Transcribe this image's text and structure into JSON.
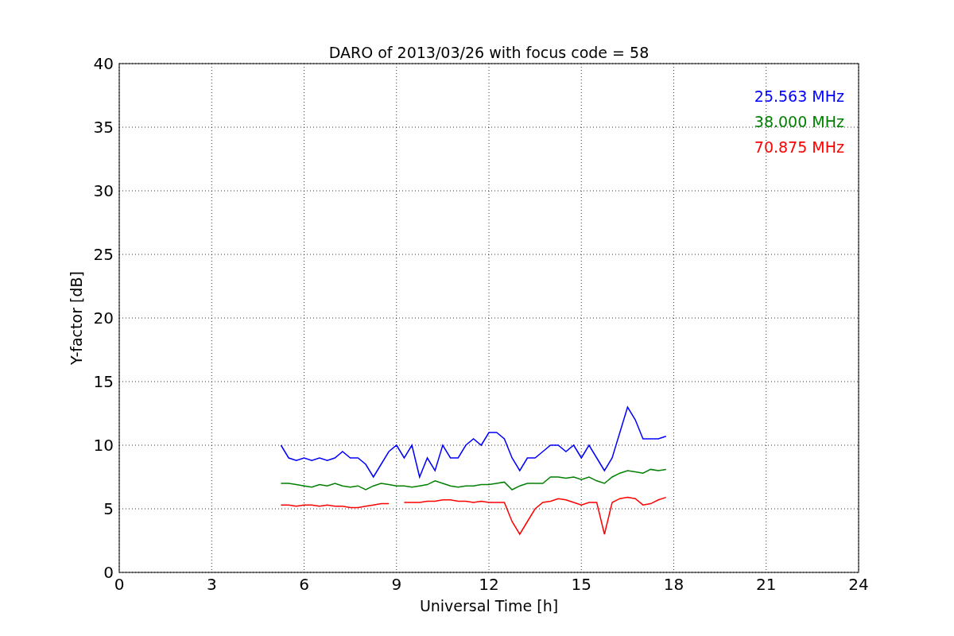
{
  "figure": {
    "chart_data": {
      "type": "line",
      "title": "DARO of 2013/03/26 with focus code = 58",
      "xlabel": "Universal Time [h]",
      "ylabel": "Y-factor [dB]",
      "xlim": [
        0,
        24
      ],
      "ylim": [
        0,
        40
      ],
      "grid": true,
      "xticks": [
        0,
        3,
        6,
        9,
        12,
        15,
        18,
        21,
        24
      ],
      "yticks": [
        0,
        5,
        10,
        15,
        20,
        25,
        30,
        35,
        40
      ],
      "x": [
        5.25,
        5.5,
        5.75,
        6,
        6.25,
        6.5,
        6.75,
        7,
        7.25,
        7.5,
        7.75,
        8,
        8.25,
        8.5,
        8.75,
        9,
        9.25,
        9.5,
        9.75,
        10,
        10.25,
        10.5,
        10.75,
        11,
        11.25,
        11.5,
        11.75,
        12,
        12.25,
        12.5,
        12.75,
        13,
        13.25,
        13.5,
        13.75,
        14,
        14.25,
        14.5,
        14.75,
        15,
        15.25,
        15.5,
        15.75,
        16,
        16.25,
        16.5,
        16.75,
        17,
        17.25,
        17.5,
        17.75
      ],
      "series": [
        {
          "name": "25.563 MHz",
          "color": "#0000ff",
          "values": [
            10,
            9,
            8.8,
            9,
            8.8,
            9,
            8.8,
            9,
            9.5,
            9,
            9,
            8.5,
            7.5,
            8.5,
            9.5,
            10,
            9,
            10,
            7.5,
            9,
            8,
            10,
            9,
            9,
            10,
            10.5,
            10,
            11,
            11,
            10.5,
            9,
            8,
            9,
            9,
            9.5,
            10,
            10,
            9.5,
            10,
            9,
            10,
            9,
            8,
            9,
            11,
            13,
            12,
            10.5,
            10.5,
            10.5,
            10.7
          ]
        },
        {
          "name": "38.000 MHz",
          "color": "#008000",
          "values": [
            7,
            7,
            6.9,
            6.8,
            6.7,
            6.9,
            6.8,
            7,
            6.8,
            6.7,
            6.8,
            6.5,
            6.8,
            7,
            6.9,
            6.8,
            6.8,
            6.7,
            6.8,
            6.9,
            7.2,
            7,
            6.8,
            6.7,
            6.8,
            6.8,
            6.9,
            6.9,
            7,
            7.1,
            6.5,
            6.8,
            7,
            7,
            7,
            7.5,
            7.5,
            7.4,
            7.5,
            7.3,
            7.5,
            7.2,
            7,
            7.5,
            7.8,
            8,
            7.9,
            7.8,
            8.1,
            8,
            8.1
          ]
        },
        {
          "name": "70.875 MHz",
          "color": "#ff0000",
          "values": [
            5.3,
            5.3,
            5.2,
            5.3,
            5.3,
            5.2,
            5.3,
            5.2,
            5.2,
            5.1,
            5.1,
            5.2,
            5.3,
            5.4,
            5.4,
            null,
            5.5,
            5.5,
            5.5,
            5.6,
            5.6,
            5.7,
            5.7,
            5.6,
            5.6,
            5.5,
            5.6,
            5.5,
            5.5,
            5.5,
            4,
            3,
            4,
            5,
            5.5,
            5.6,
            5.8,
            5.7,
            5.5,
            5.3,
            5.5,
            5.5,
            3,
            5.5,
            5.8,
            5.9,
            5.8,
            5.3,
            5.4,
            5.7,
            5.9
          ]
        }
      ]
    }
  }
}
